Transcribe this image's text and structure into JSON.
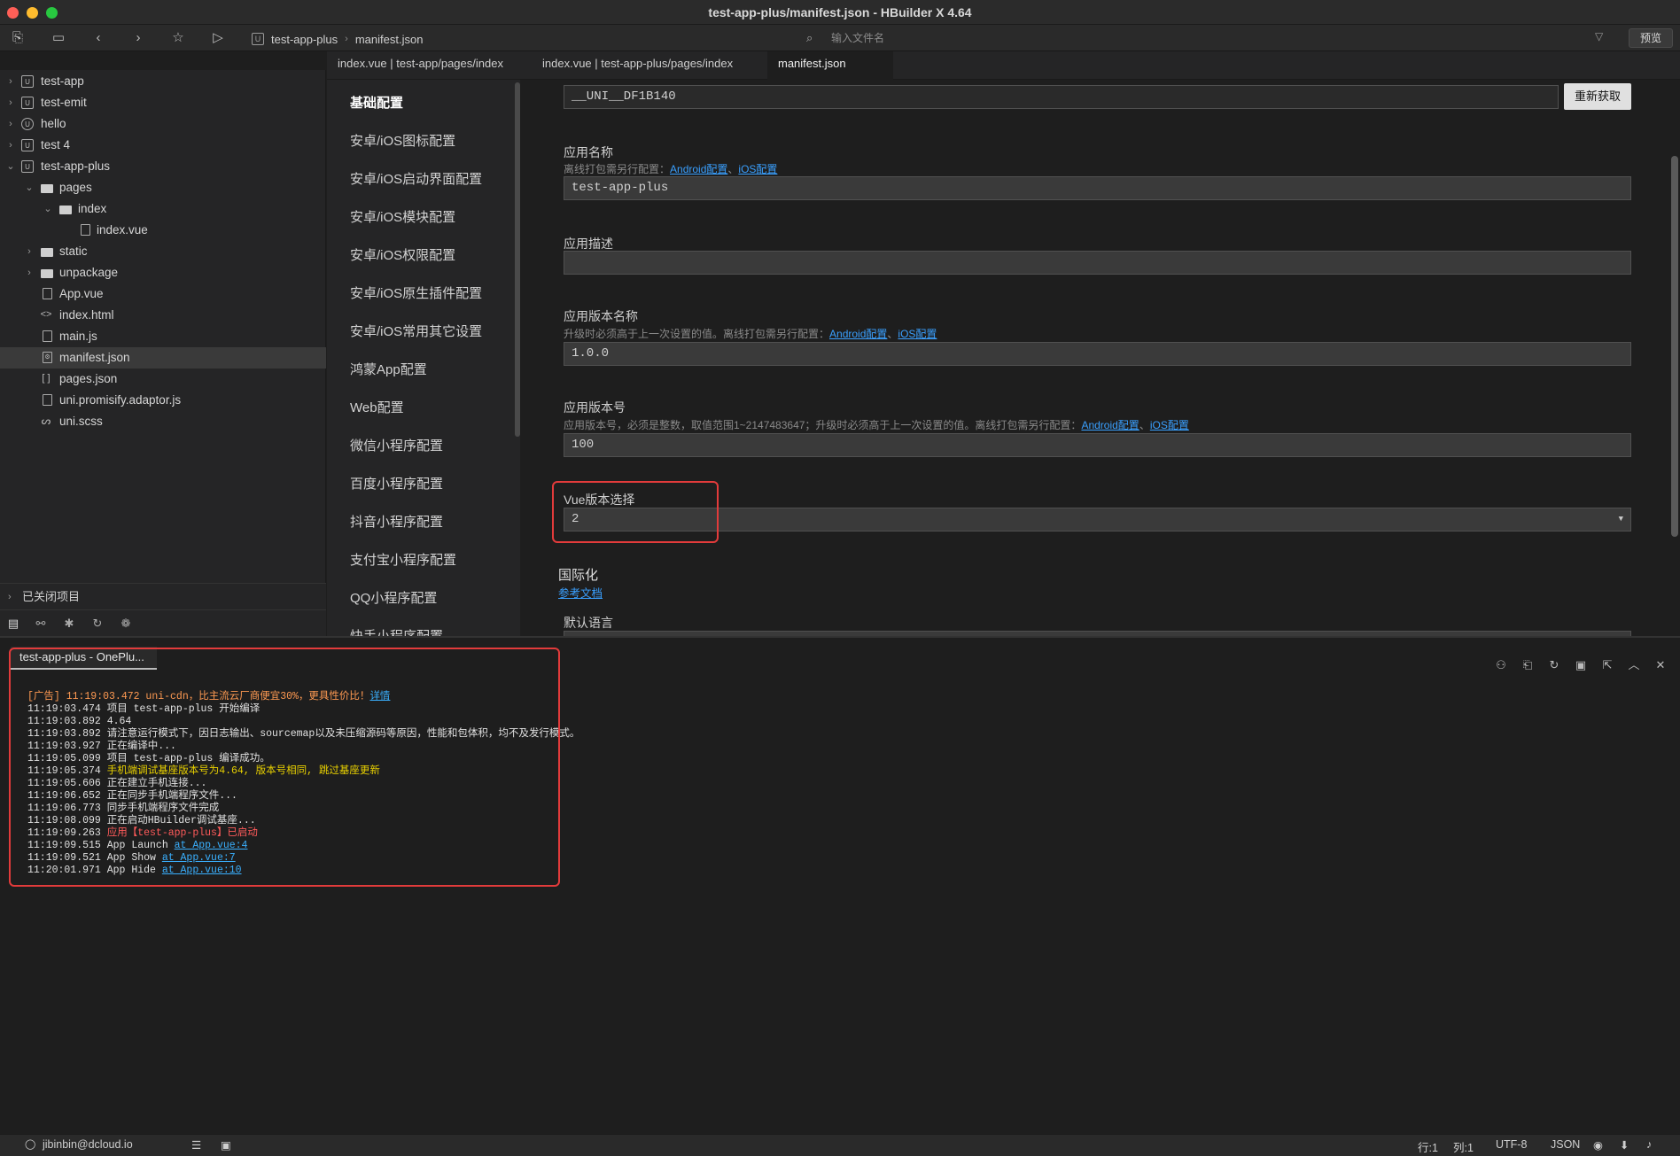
{
  "window": {
    "title": "test-app-plus/manifest.json - HBuilder X 4.64"
  },
  "toolbar": {
    "breadcrumb": [
      "test-app-plus",
      "manifest.json"
    ],
    "file_search_placeholder": "输入文件名",
    "preview_label": "预览",
    "icons": [
      "new-file-icon",
      "save-icon",
      "back-icon",
      "forward-icon",
      "star-icon",
      "run-icon"
    ]
  },
  "sidebar": {
    "items": [
      {
        "label": "test-app",
        "depth": 0,
        "expanded": false,
        "icon": "project-icon"
      },
      {
        "label": "test-emit",
        "depth": 0,
        "expanded": false,
        "icon": "project-icon"
      },
      {
        "label": "hello",
        "depth": 0,
        "expanded": false,
        "icon": "uni-icon"
      },
      {
        "label": "test 4",
        "depth": 0,
        "expanded": false,
        "icon": "project-icon"
      },
      {
        "label": "test-app-plus",
        "depth": 0,
        "expanded": true,
        "icon": "project-icon"
      },
      {
        "label": "pages",
        "depth": 1,
        "expanded": true,
        "icon": "folder-icon"
      },
      {
        "label": "index",
        "depth": 2,
        "expanded": true,
        "icon": "folder-icon"
      },
      {
        "label": "index.vue",
        "depth": 3,
        "icon": "vue-file-icon"
      },
      {
        "label": "static",
        "depth": 1,
        "expanded": false,
        "icon": "folder-icon"
      },
      {
        "label": "unpackage",
        "depth": 1,
        "expanded": false,
        "icon": "folder-icon"
      },
      {
        "label": "App.vue",
        "depth": 1,
        "icon": "vue-file-icon"
      },
      {
        "label": "index.html",
        "depth": 1,
        "icon": "html-file-icon"
      },
      {
        "label": "main.js",
        "depth": 1,
        "icon": "js-file-icon"
      },
      {
        "label": "manifest.json",
        "depth": 1,
        "icon": "json-settings-icon",
        "selected": true
      },
      {
        "label": "pages.json",
        "depth": 1,
        "icon": "json-file-icon"
      },
      {
        "label": "uni.promisify.adaptor.js",
        "depth": 1,
        "icon": "js-file-icon"
      },
      {
        "label": "uni.scss",
        "depth": 1,
        "icon": "scss-file-icon"
      }
    ],
    "closed_projects_label": "已关闭项目"
  },
  "tabs": [
    {
      "label": "index.vue | test-app/pages/index",
      "active": false
    },
    {
      "label": "index.vue | test-app-plus/pages/index",
      "active": false
    },
    {
      "label": "manifest.json",
      "active": true
    }
  ],
  "config_nav": [
    {
      "label": "基础配置",
      "active": true
    },
    {
      "label": "安卓/iOS图标配置"
    },
    {
      "label": "安卓/iOS启动界面配置"
    },
    {
      "label": "安卓/iOS模块配置"
    },
    {
      "label": "安卓/iOS权限配置"
    },
    {
      "label": "安卓/iOS原生插件配置"
    },
    {
      "label": "安卓/iOS常用其它设置"
    },
    {
      "label": "鸿蒙App配置"
    },
    {
      "label": "Web配置"
    },
    {
      "label": "微信小程序配置"
    },
    {
      "label": "百度小程序配置"
    },
    {
      "label": "抖音小程序配置"
    },
    {
      "label": "支付宝小程序配置"
    },
    {
      "label": "QQ小程序配置"
    },
    {
      "label": "快手小程序配置"
    }
  ],
  "form": {
    "appid_value": "__UNI__DF1B140",
    "refetch_label": "重新获取",
    "app_name": {
      "label": "应用名称",
      "hint": "离线打包需另行配置：",
      "link_android": "Android配置",
      "sep": "、",
      "link_ios": "iOS配置",
      "value": "test-app-plus"
    },
    "app_desc": {
      "label": "应用描述",
      "value": ""
    },
    "version_name": {
      "label": "应用版本名称",
      "hint": "升级时必须高于上一次设置的值。离线打包需另行配置：",
      "link_android": "Android配置",
      "sep": "、",
      "link_ios": "iOS配置",
      "value": "1.0.0"
    },
    "version_code": {
      "label": "应用版本号",
      "hint": "应用版本号，必须是整数，取值范围1~2147483647；升级时必须高于上一次设置的值。离线打包需另行配置：",
      "link_android": "Android配置",
      "sep": "、",
      "link_ios": "iOS配置",
      "value": "100"
    },
    "vue_version": {
      "label": "Vue版本选择",
      "value": "2"
    },
    "i18n": {
      "title": "国际化",
      "doc_link": "参考文档",
      "default_lang_label": "默认语言"
    }
  },
  "console": {
    "tab_label": "test-app-plus - OnePlu...",
    "lines": [
      {
        "text": "[广告] 11:19:03.472 uni-cdn，比主流云厂商便宜30%，更具性价比！",
        "link": "详情",
        "style": "ad"
      },
      {
        "text": "11:19:03.474 项目 test-app-plus 开始编译"
      },
      {
        "text": "11:19:03.892 4.64"
      },
      {
        "text": "11:19:03.892 请注意运行模式下，因日志输出、sourcemap以及未压缩源码等原因，性能和包体积，均不及发行模式。"
      },
      {
        "text": "11:19:03.927 正在编译中..."
      },
      {
        "text": "11:19:05.099 项目 test-app-plus 编译成功。"
      },
      {
        "text": "11:19:05.374 ",
        "colored": "手机端调试基座版本号为4.64, 版本号相同, 跳过基座更新",
        "style": "warn"
      },
      {
        "text": "11:19:05.606 正在建立手机连接..."
      },
      {
        "text": "11:19:06.652 正在同步手机端程序文件..."
      },
      {
        "text": "11:19:06.773 同步手机端程序文件完成"
      },
      {
        "text": "11:19:08.099 正在启动HBuilder调试基座..."
      },
      {
        "text": "11:19:09.263 ",
        "colored": "应用【test-app-plus】已启动",
        "style": "err"
      },
      {
        "text": "11:19:09.515 App Launch ",
        "link": "at App.vue:4"
      },
      {
        "text": "11:19:09.521 App Show ",
        "link": "at App.vue:7"
      },
      {
        "text": "11:20:01.971 App Hide ",
        "link": "at App.vue:10"
      }
    ]
  },
  "statusbar": {
    "user": "jibinbin@dcloud.io",
    "line": "行:1",
    "col": "列:1",
    "encoding": "UTF-8",
    "language": "JSON"
  }
}
